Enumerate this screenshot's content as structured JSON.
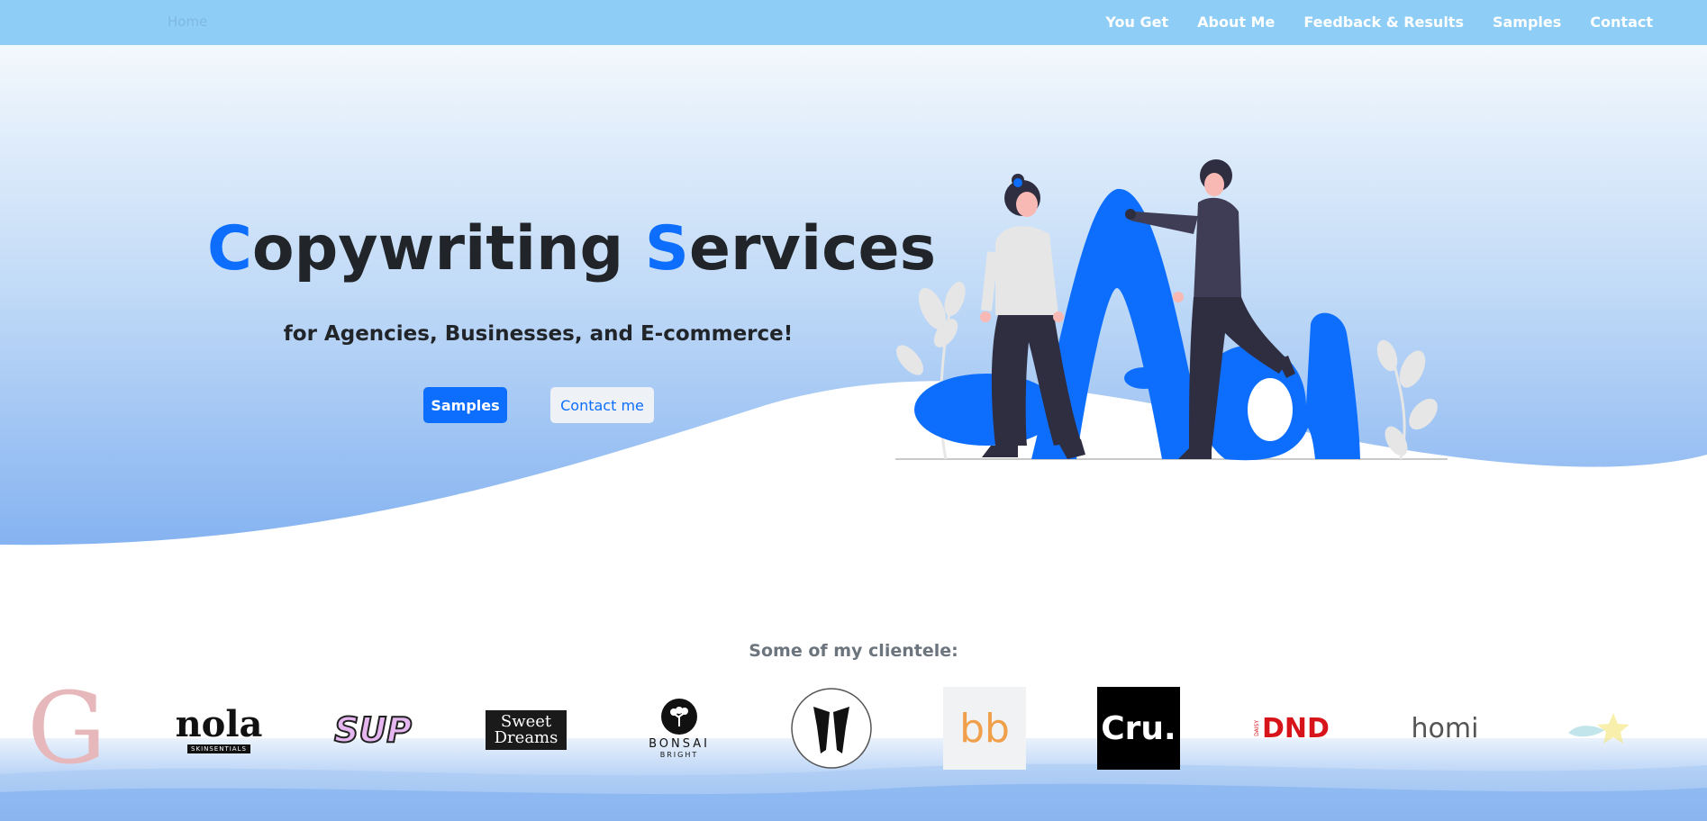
{
  "nav": {
    "home": "Home",
    "links": [
      "You Get",
      "About Me",
      "Feedback & Results",
      "Samples",
      "Contact"
    ]
  },
  "hero": {
    "title_c": "C",
    "title_mid": "opywriting ",
    "title_s": "S",
    "title_end": "ervices",
    "subtitle": "for Agencies, Businesses, and E-commerce!",
    "btn_samples": "Samples",
    "btn_contact": "Contact me"
  },
  "clients": {
    "title": "Some of my clientele:",
    "logos": {
      "g": "G",
      "nola": "nola",
      "nola_sub": "SKINSENTIALS",
      "sup": "SUP",
      "sweet1": "Sweet",
      "sweet2": "Dreams",
      "bonsai": "BONSAI",
      "bonsai_sub": "BRIGHT",
      "bb": "bb",
      "cru": "Cru.",
      "dnd_small": "DAISY",
      "dnd": "DND",
      "homi": "homi"
    }
  },
  "colors": {
    "nav": "#8ecdf5",
    "accent": "#0d6efd",
    "dark": "#212529",
    "muted": "#6c757d"
  }
}
